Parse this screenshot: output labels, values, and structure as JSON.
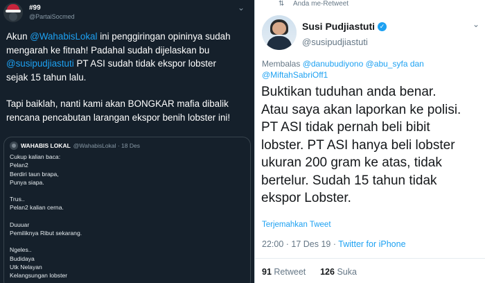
{
  "left_tweet": {
    "display_name": "#99",
    "handle": "@PartaiSocmed",
    "text_lines": [
      {
        "parts": [
          {
            "t": "Akun ",
            "m": false
          },
          {
            "t": "@WahabisLokal",
            "m": true
          },
          {
            "t": " ini penggiringan opininya sudah",
            "m": false
          }
        ]
      },
      {
        "parts": [
          {
            "t": "mengarah ke fitnah! Padahal sudah dijelaskan bu",
            "m": false
          }
        ]
      },
      {
        "parts": [
          {
            "t": "@susipudjiastuti",
            "m": true
          },
          {
            "t": " PT ASI sudah tidak ekspor lobster",
            "m": false
          }
        ]
      },
      {
        "parts": [
          {
            "t": "sejak 15 tahun lalu.",
            "m": false
          }
        ]
      },
      {
        "parts": []
      },
      {
        "parts": [
          {
            "t": "Tapi baiklah, nanti kami akan BONGKAR mafia dibalik",
            "m": false
          }
        ]
      },
      {
        "parts": [
          {
            "t": "rencana pencabutan larangan ekspor benih lobster ini!",
            "m": false
          }
        ]
      }
    ],
    "quote": {
      "name": "WAHABIS LOKAL",
      "handle_date": "@WahabisLokal · 18 Des",
      "lines": [
        "Cukup kalian baca:",
        "Pelan2",
        "Berdiri taun brapa,",
        "Punya siapa.",
        "",
        "Trus..",
        "Pelan2 kalian cerna.",
        "",
        "Duuuar",
        "Pemiliknya Ribut sekarang.",
        "",
        "Ngeles..",
        "Budidaya",
        "Utk Nelayan",
        "Kelangsungan lobster"
      ]
    }
  },
  "right_tweet": {
    "retweet_label": "Anda me-Retweet",
    "display_name": "Susi Pudjiastuti",
    "handle": "@susipudjiastuti",
    "reply_prefix": "Membalas ",
    "reply_mentions": "@danubudiyono @abu_syfa dan",
    "reply_mentions_2": "@MiftahSabriOff1",
    "text_lines": [
      "Buktikan tuduhan anda benar.",
      "Atau saya akan laporkan ke polisi.",
      "PT ASI tidak pernah beli bibit",
      "lobster. PT ASI hanya beli lobster",
      "ukuran 200 gram ke atas, tidak",
      "bertelur. Sudah 15 tahun tidak",
      "ekspor Lobster."
    ],
    "translate_label": "Terjemahkan Tweet",
    "time": "22:00",
    "date": "17 Des 19",
    "source": "Twitter for iPhone",
    "retweets_count": "91",
    "retweets_label": "Retweet",
    "likes_count": "126",
    "likes_label": "Suka"
  },
  "colors": {
    "dark_bg": "#15202b",
    "link_blue": "#1da1f2",
    "muted_gray": "#657786"
  }
}
